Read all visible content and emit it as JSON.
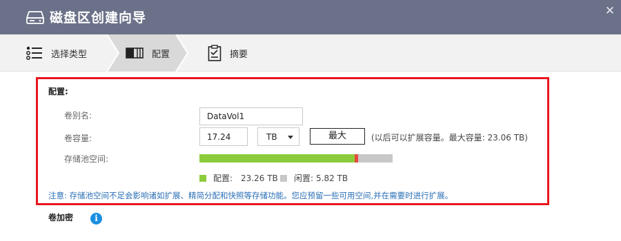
{
  "window": {
    "title": "磁盘区创建向导",
    "icon": "disk-icon",
    "close_glyph": "✕"
  },
  "steps": [
    {
      "label": "选择类型",
      "icon": "list-icon",
      "active": false
    },
    {
      "label": "配置",
      "icon": "volume-icon",
      "active": true
    },
    {
      "label": "摘要",
      "icon": "clipboard-icon",
      "active": false
    }
  ],
  "config": {
    "section_title": "配置:",
    "alias_label": "卷别名:",
    "alias_value": "DataVol1",
    "capacity_label": "卷容量:",
    "capacity_value": "17.24",
    "unit_value": "TB",
    "max_button": "最大",
    "capacity_hint": "(以后可以扩展容量。最大容量: 23.06 TB)",
    "pool_label": "存储池空间:",
    "pool_used_fraction": 0.823,
    "pool_marker_fraction": 0.8,
    "legend": {
      "used_label": "配置:",
      "used_value": "23.26 TB",
      "free_label": "闲置:",
      "free_value": "5.82 TB"
    },
    "note": "注意: 存储池空间不足会影响诸如扩展、精简分配和快照等存储功能。您应预留一些可用空间,并在需要时进行扩展。"
  },
  "encryption": {
    "label": "卷加密",
    "info_glyph": "i"
  },
  "colors": {
    "titlebar": "#6b7188",
    "highlight_border": "#e8141e",
    "used": "#8ccc3c",
    "marker": "#e84a3c",
    "free": "#c8c8c8",
    "note": "#2b6fb6",
    "info": "#1a8fe0"
  }
}
